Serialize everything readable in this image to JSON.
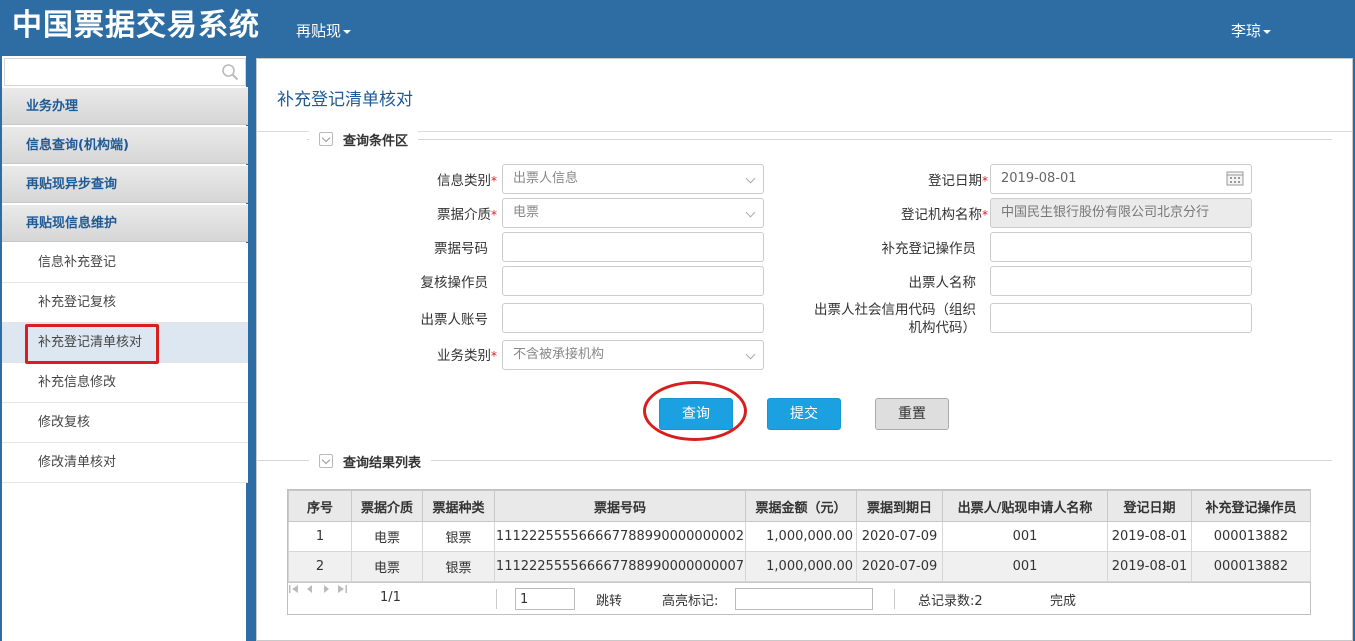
{
  "header": {
    "app_title": "中国票据交易系统",
    "menu_label": "再贴现",
    "user_name": "李琼"
  },
  "sidebar": {
    "search_placeholder": "",
    "groups": [
      {
        "label": "业务办理"
      },
      {
        "label": "信息查询(机构端)"
      },
      {
        "label": "再贴现异步查询"
      },
      {
        "label": "再贴现信息维护"
      }
    ],
    "items": [
      {
        "label": "信息补充登记"
      },
      {
        "label": "补充登记复核"
      },
      {
        "label": "补充登记清单核对"
      },
      {
        "label": "补充信息修改"
      },
      {
        "label": "修改复核"
      },
      {
        "label": "修改清单核对"
      }
    ]
  },
  "main": {
    "page_title": "补充登记清单核对",
    "query_section": "查询条件区",
    "result_section": "查询结果列表",
    "form": {
      "info_type_label": "信息类别",
      "info_type_value": "出票人信息",
      "medium_label": "票据介质",
      "medium_value": "电票",
      "bill_no_label": "票据号码",
      "reviewer_label": "复核操作员",
      "drawer_account_label": "出票人账号",
      "biz_type_label": "业务类别",
      "biz_type_value": "不含被承接机构",
      "reg_date_label": "登记日期",
      "reg_date_value": "2019-08-01",
      "reg_org_label": "登记机构名称",
      "reg_org_value": "中国民生银行股份有限公司北京分行",
      "supp_operator_label": "补充登记操作员",
      "drawer_name_label": "出票人名称",
      "credit_code_label_1": "出票人社会信用代码（组织",
      "credit_code_label_2": "机构代码）"
    },
    "buttons": {
      "query": "查询",
      "submit": "提交",
      "reset": "重置"
    },
    "table": {
      "columns": [
        "序号",
        "票据介质",
        "票据种类",
        "票据号码",
        "票据金额（元）",
        "票据到期日",
        "出票人/贴现申请人名称",
        "登记日期",
        "补充登记操作员"
      ],
      "rows": [
        [
          "1",
          "电票",
          "银票",
          "111222555566667788990000000002",
          "1,000,000.00",
          "2020-07-09",
          "001",
          "2019-08-01",
          "000013882"
        ],
        [
          "2",
          "电票",
          "银票",
          "111222555566667788990000000007",
          "1,000,000.00",
          "2020-07-09",
          "001",
          "2019-08-01",
          "000013882"
        ]
      ]
    },
    "pager": {
      "page_info": "1/1",
      "jump_value": "1",
      "jump_label": "跳转",
      "highlight_label": "高亮标记:",
      "total": "总记录数:2",
      "status": "完成"
    }
  }
}
